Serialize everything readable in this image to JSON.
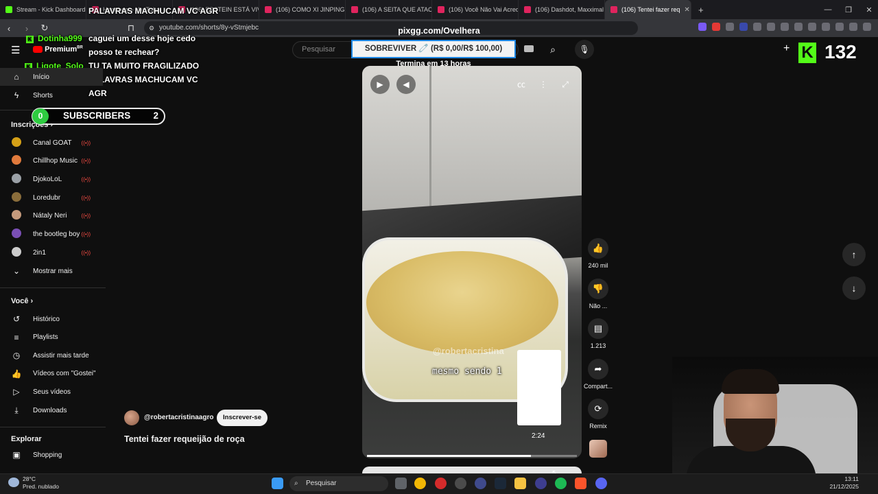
{
  "browser": {
    "tabs": [
      {
        "label": "Stream - Kick Dashboard",
        "favicon": "kick"
      },
      {
        "label": "Heartbeat - YouTube",
        "favicon": "youtube"
      },
      {
        "label": "(106) EPSTEIN ESTÁ VIVO",
        "favicon": "youtube"
      },
      {
        "label": "(106) COMO XI JINPING C",
        "favicon": "youtube"
      },
      {
        "label": "(106) A SEITA QUE ATACO",
        "favicon": "youtube"
      },
      {
        "label": "(106) Você Não Vai Acredi",
        "favicon": "youtube"
      },
      {
        "label": "(106) Dashdot, Maxximal",
        "favicon": "youtube"
      },
      {
        "label": "(106) Tentei fazer req",
        "favicon": "youtube",
        "active": true
      }
    ],
    "new_tab": "+",
    "url": "youtube.com/shorts/8y-vStmjebc"
  },
  "youtube": {
    "search_placeholder": "Pesquisar",
    "sidebar": {
      "main": [
        {
          "label": "Início",
          "icon": "home-icon"
        },
        {
          "label": "Shorts",
          "icon": "shorts-icon"
        }
      ],
      "subscriptions_title": "Inscrições",
      "subscriptions": [
        {
          "label": "Canal GOAT",
          "avatar_color": "#d4a017"
        },
        {
          "label": "Chillhop Music",
          "avatar_color": "#e07a3c"
        },
        {
          "label": "DjokoLoL",
          "avatar_color": "#9aa0a6"
        },
        {
          "label": "Loredubr",
          "avatar_color": "#8a6d3b"
        },
        {
          "label": "Nátaly Neri",
          "avatar_color": "#c59a7c"
        },
        {
          "label": "the bootleg boy",
          "avatar_color": "#7a4fb5"
        },
        {
          "label": "2in1",
          "avatar_color": "#cccccc"
        }
      ],
      "show_more": "Mostrar mais",
      "you_title": "Você",
      "you": [
        {
          "label": "Histórico",
          "icon": "history-icon"
        },
        {
          "label": "Playlists",
          "icon": "playlist-icon"
        },
        {
          "label": "Assistir mais tarde",
          "icon": "clock-icon"
        },
        {
          "label": "Vídeos com \"Gostei\"",
          "icon": "thumbs-up-icon"
        },
        {
          "label": "Seus vídeos",
          "icon": "video-icon"
        },
        {
          "label": "Downloads",
          "icon": "download-icon"
        }
      ],
      "explore_title": "Explorar",
      "explore": [
        {
          "label": "Shopping",
          "icon": "shopping-icon"
        }
      ]
    },
    "short": {
      "channel": "@robertacristinaagro",
      "subscribe_label": "Inscrever-se",
      "title": "Tentei fazer requeijão de roça",
      "watermark": "@robertacristina",
      "caption": "mesmo sendo 1",
      "progress_fraction": 0.78,
      "timestamp": "2:24"
    },
    "actions": [
      {
        "label": "240 mil",
        "icon": "thumbs-up-icon"
      },
      {
        "label": "Não ...",
        "icon": "thumbs-down-icon"
      },
      {
        "label": "1.213",
        "icon": "comment-icon"
      },
      {
        "label": "Compart...",
        "icon": "share-icon"
      },
      {
        "label": "Remix",
        "icon": "remix-icon"
      }
    ]
  },
  "overlay": {
    "pix_url": "pixgg.com/Ovelhera",
    "goal_text": "SOBREVIVER 🧷 (R$ 0,00/R$ 100,00)",
    "goal_sub": "Termina em 13 horas",
    "chat": [
      {
        "user": "Dotinha999",
        "message": "caguei um desse hoje cedo posso te rechear?"
      },
      {
        "user": "Ligote_Solo",
        "message": "TU TA MUITO FRAGILIZADO PALAVRAS MACHUCAM VC AGR"
      }
    ],
    "top_message": "PALAVRAS MACHUCAM VC AGR",
    "sub_goal": {
      "current": "0",
      "label": "SUBSCRIBERS",
      "target": "2"
    },
    "viewer_count": "132",
    "premium_label": "Premium",
    "premium_badge": "BR"
  },
  "taskbar": {
    "weather_temp": "28°C",
    "weather_desc": "Pred. nublado",
    "search_label": "Pesquisar",
    "time": "13:11",
    "date": "21/12/2025"
  }
}
